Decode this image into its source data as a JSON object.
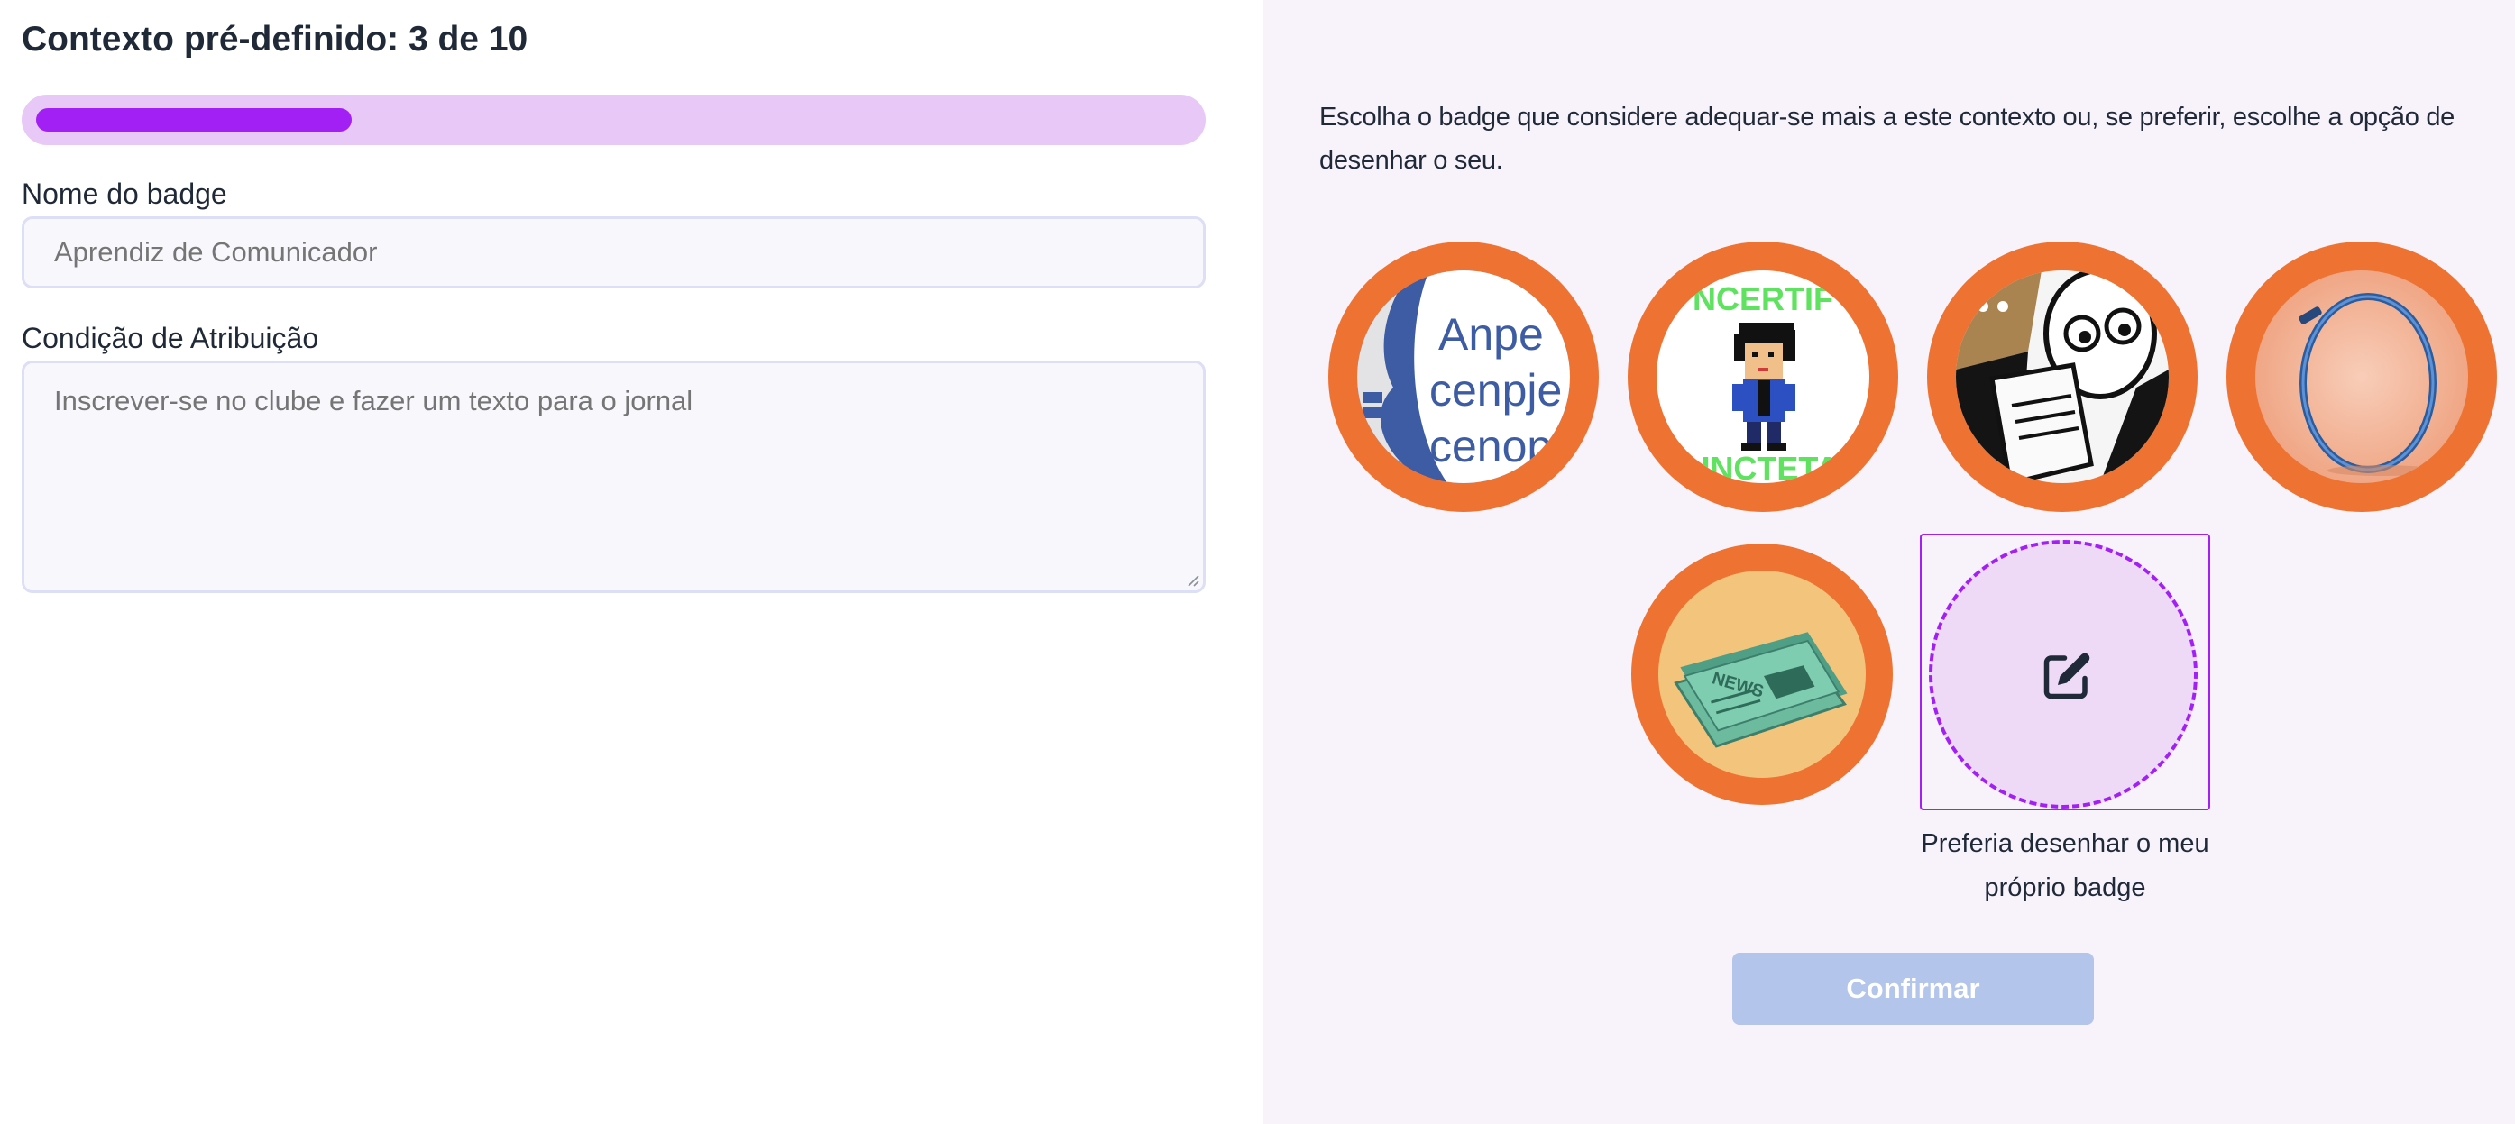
{
  "header": {
    "title": "Contexto pré-definido: 3 de 10",
    "progress": 0.3
  },
  "form": {
    "name_label": "Nome do badge",
    "name_placeholder": "Aprendiz de Comunicador",
    "condition_label": "Condição de Atribuição",
    "condition_placeholder": "Inscrever-se no clube e fazer um texto para o jornal"
  },
  "panel": {
    "intro": "Escolha o badge que considere adequar-se mais a este contexto ou, se preferir, escolhe a opção de desenhar o seu.",
    "badges": [
      {
        "name": "badge-ampersand",
        "text": [
          "Anpe",
          "cenpje",
          "cenop"
        ]
      },
      {
        "name": "badge-pixel-character",
        "text": [
          "NCERTIF",
          "UNCTETA"
        ]
      },
      {
        "name": "badge-reading-comic"
      },
      {
        "name": "badge-blue-ring"
      },
      {
        "name": "badge-newspaper",
        "text": [
          "NEWS"
        ]
      }
    ],
    "draw_option": {
      "icon": "edit-icon",
      "caption": "Preferia desenhar o meu próprio badge"
    },
    "confirm_label": "Confirmar"
  },
  "colors": {
    "accent": "#a320f4",
    "progress_track": "#e8c8f7",
    "badge_ring": "#ee7333",
    "panel_bg": "#f8f2fb",
    "confirm_disabled": "#b3c5ea"
  }
}
